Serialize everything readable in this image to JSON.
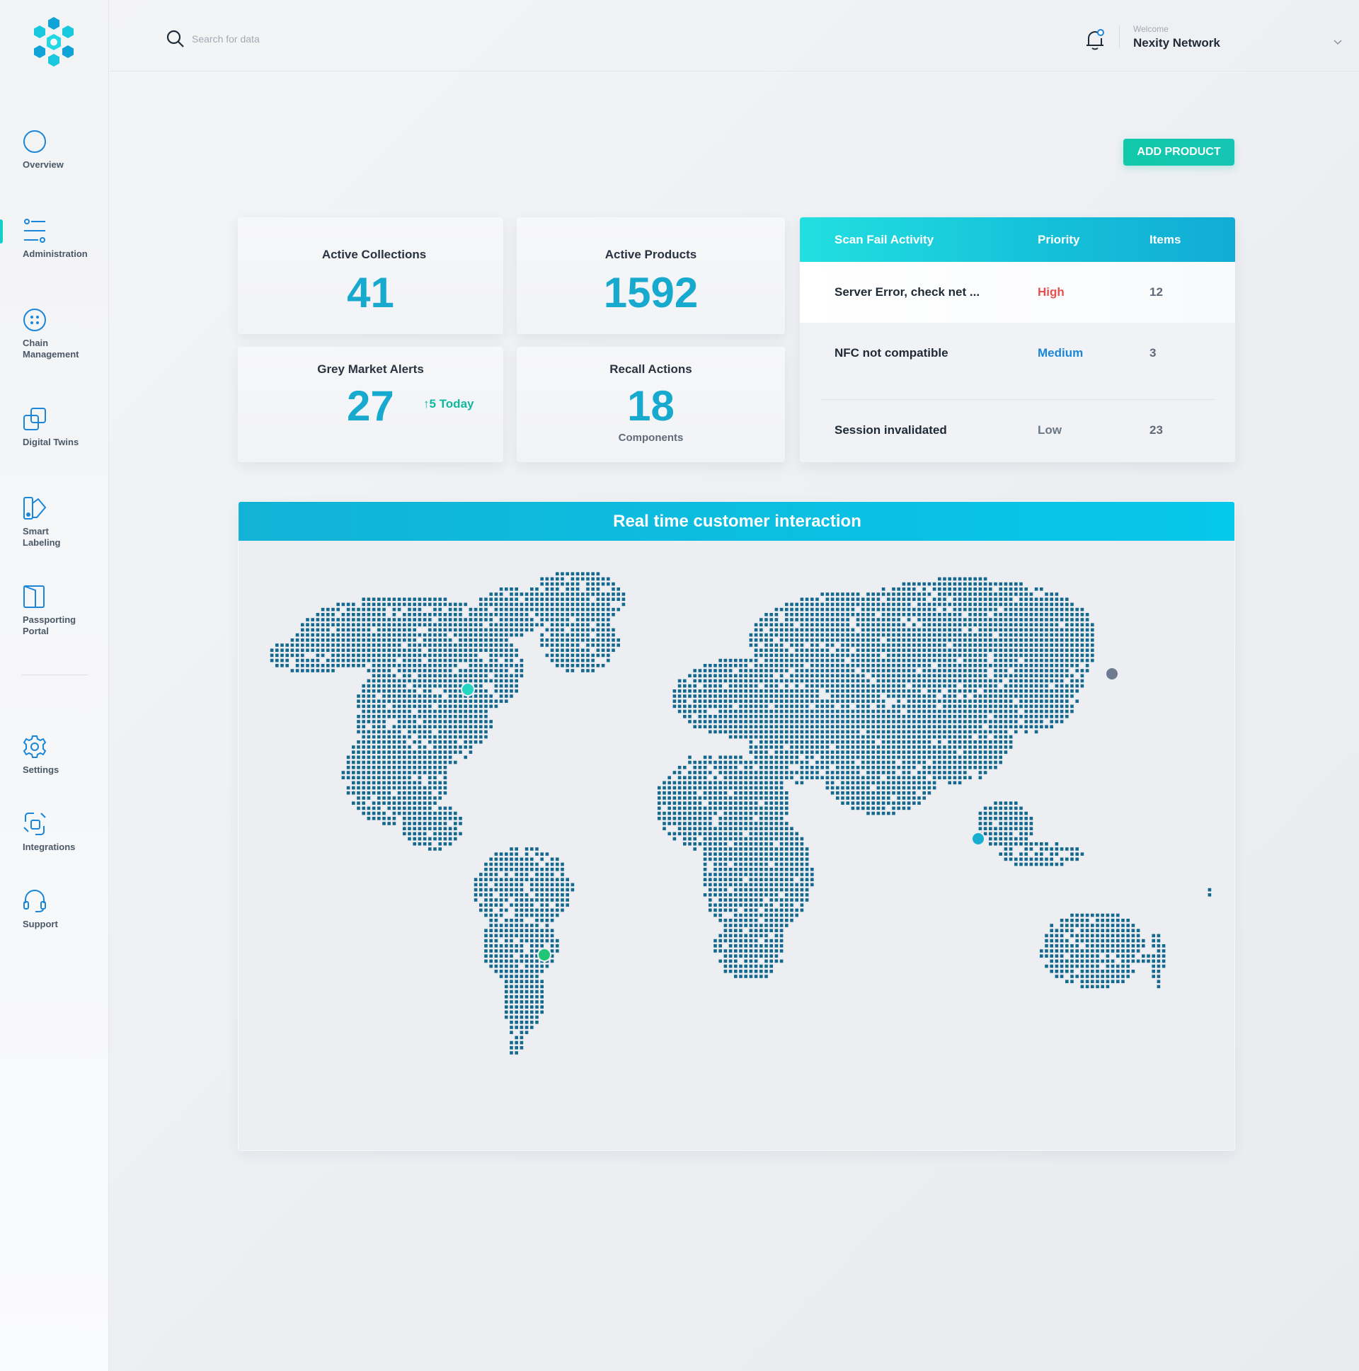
{
  "search": {
    "placeholder": "Search for data"
  },
  "sidebar": {
    "items": [
      {
        "label": "Overview",
        "icon": "circle-icon"
      },
      {
        "label": "Administration",
        "icon": "sliders-icon"
      },
      {
        "label": "Chain\nManagement",
        "icon": "chain-icon"
      },
      {
        "label": "Digital Twins",
        "icon": "twins-icon"
      },
      {
        "label": "Smart\nLabeling",
        "icon": "label-icon"
      },
      {
        "label": "Passporting\nPortal",
        "icon": "passport-icon"
      },
      {
        "label": "Settings",
        "icon": "gear-icon"
      },
      {
        "label": "Integrations",
        "icon": "integrations-icon"
      },
      {
        "label": "Support",
        "icon": "headset-icon"
      }
    ]
  },
  "header": {
    "welcome": "Welcome",
    "user_name": "Nexity Network"
  },
  "actions": {
    "add_product": "ADD PRODUCT"
  },
  "stats": {
    "active_collections": {
      "title": "Active Collections",
      "value": "41"
    },
    "active_products": {
      "title": "Active Products",
      "value": "1592"
    },
    "grey_market": {
      "title": "Grey Market Alerts",
      "value": "27",
      "trend": "5 Today"
    },
    "recall": {
      "title": "Recall Actions",
      "value": "18",
      "sub": "Components"
    }
  },
  "scan_fail": {
    "headers": {
      "activity": "Scan Fail Activity",
      "priority": "Priority",
      "items": "Items"
    },
    "rows": [
      {
        "activity": "Server Error, check net ...",
        "priority": "High",
        "items": "12",
        "priority_color": "#e8504f"
      },
      {
        "activity": "NFC not compatible",
        "priority": "Medium",
        "items": "3",
        "priority_color": "#1a86d9"
      },
      {
        "activity": "Session invalidated",
        "priority": "Low",
        "items": "23",
        "priority_color": "#6b7785"
      }
    ]
  },
  "map": {
    "title": "Real time customer interaction"
  },
  "colors": {
    "accent": "#18a9cf",
    "teal": "#11c9a9",
    "map_dot": "#15698e",
    "marker_colors": [
      "#24d6c0",
      "#1ec676",
      "#17aed1",
      "#6f7b8e"
    ]
  }
}
